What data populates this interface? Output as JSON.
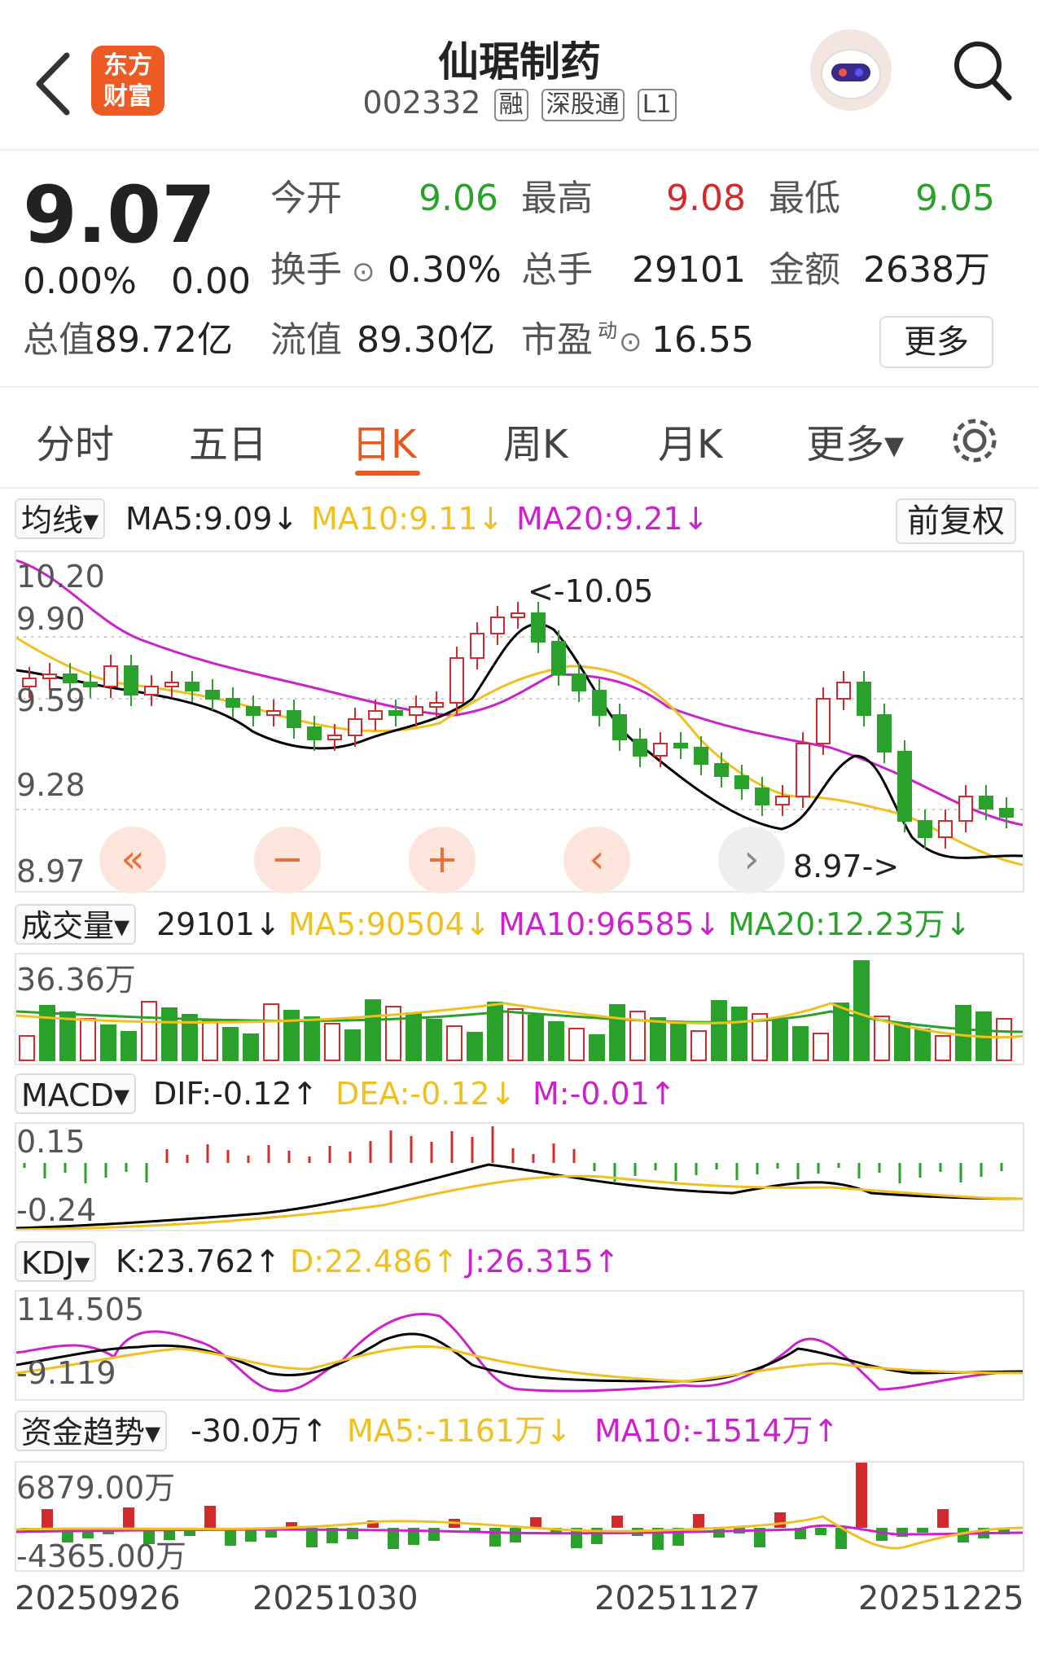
{
  "header": {
    "title": "仙琚制药",
    "code": "002332",
    "tags": [
      "融",
      "深股通",
      "L1"
    ],
    "logo": "东方\n财富",
    "back_icon": "chevron-left-icon",
    "search_icon": "search-icon",
    "robot_icon": "robot-avatar-icon"
  },
  "quote": {
    "price": "9.07",
    "change_pct": "0.00%",
    "change": "0.00",
    "open_label": "今开",
    "open": "9.06",
    "high_label": "最高",
    "high": "9.08",
    "low_label": "最低",
    "low": "9.05",
    "turnover_label": "换手",
    "turnover": "0.30%",
    "volume_label": "总手",
    "volume": "29101",
    "amount_label": "金额",
    "amount": "2638万",
    "mktcap_label": "总值",
    "mktcap": "89.72亿",
    "float_label": "流值",
    "float": "89.30亿",
    "pe_label": "市盈",
    "pe_sup": "动",
    "pe": "16.55",
    "more": "更多"
  },
  "tabs": {
    "items": [
      "分时",
      "五日",
      "日K",
      "周K",
      "月K",
      "更多▾"
    ],
    "active": 2
  },
  "ma_bar": {
    "btn": "均线▾",
    "ma5": "MA5:9.09↓",
    "ma10": "MA10:9.11↓",
    "ma20": "MA20:9.21↓",
    "adjust": "前复权"
  },
  "kline": {
    "y_labels": [
      "10.20",
      "9.90",
      "9.59",
      "9.28",
      "8.97"
    ],
    "max_note": "<-10.05",
    "min_note": "8.97->",
    "controls": [
      "«",
      "−",
      "+",
      "‹",
      "›"
    ]
  },
  "vol_bar": {
    "btn": "成交量▾",
    "vol": "29101↓",
    "ma5": "MA5:90504↓",
    "ma10": "MA10:96585↓",
    "ma20": "MA20:12.23万↓",
    "y_label": "36.36万"
  },
  "macd_bar": {
    "btn": "MACD▾",
    "dif": "DIF:-0.12↑",
    "dea": "DEA:-0.12↓",
    "m": "M:-0.01↑",
    "y_top": "0.15",
    "y_bot": "-0.24"
  },
  "kdj_bar": {
    "btn": "KDJ▾",
    "k": "K:23.762↑",
    "d": "D:22.486↑",
    "j": "J:26.315↑",
    "y_top": "114.505",
    "y_bot": "-9.119"
  },
  "fund_bar": {
    "btn": "资金趋势▾",
    "val": "-30.0万↑",
    "ma5": "MA5:-1161万↓",
    "ma10": "MA10:-1514万↑",
    "y_top": "6879.00万",
    "y_bot": "-4365.00万"
  },
  "dates": [
    "20250926",
    "20251030",
    "20251127",
    "20251225"
  ],
  "colors": {
    "up": "#d32b2b",
    "down": "#2aa12a",
    "ma5": "#000000",
    "ma10": "#f0c020",
    "ma20": "#cc22cc",
    "accent": "#e8571b"
  }
}
